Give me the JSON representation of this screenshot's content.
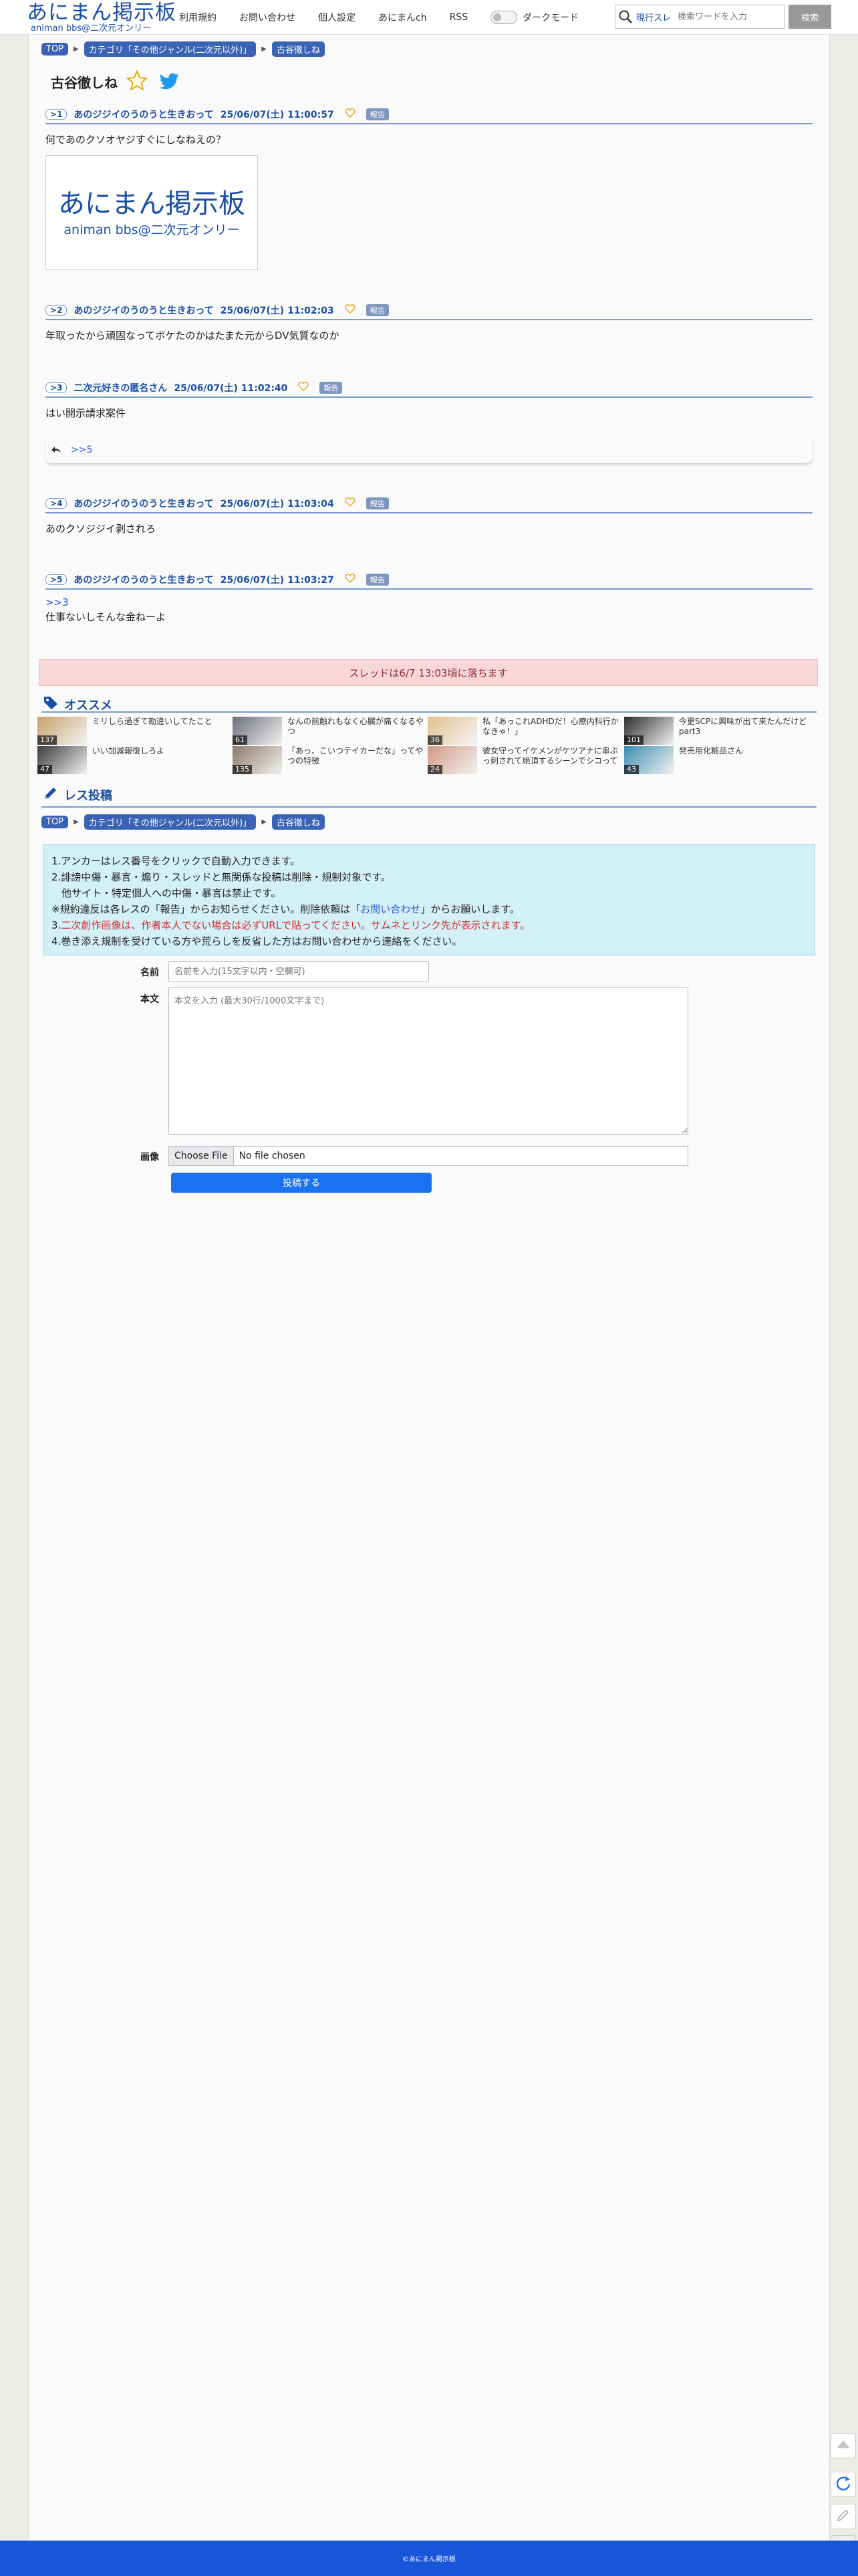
{
  "header": {
    "logo_main": "あにまん掲示板",
    "logo_sub": "animan bbs@二次元オンリー",
    "nav": [
      "利用規約",
      "お問い合わせ",
      "個人設定",
      "あにまんch",
      "RSS"
    ],
    "dark_mode_label": "ダークモード",
    "search_scope": "現行スレ",
    "search_placeholder": "検索ワードを入力",
    "search_button": "検索"
  },
  "breadcrumb": [
    "TOP",
    "カテゴリ「その他ジャンル(二次元以外)」",
    "古谷徹しね"
  ],
  "thread": {
    "title": "古谷徹しね"
  },
  "report_label": "報告",
  "posts": [
    {
      "num": "1",
      "name": "あのジジイのうのうと生きおって",
      "date": "25/06/07(土) 11:00:57",
      "body": "何であのクソオヤジすぐにしなねえの？"
    },
    {
      "num": "2",
      "name": "あのジジイのうのうと生きおって",
      "date": "25/06/07(土) 11:02:03",
      "body": "年取ったから頑固なってボケたのかはたまた元からDV気質なのか"
    },
    {
      "num": "3",
      "name": "二次元好きの匿名さん",
      "date": "25/06/07(土) 11:02:40",
      "body": "はい開示請求案件"
    },
    {
      "num": "4",
      "name": "あのジジイのうのうと生きおって",
      "date": "25/06/07(土) 11:03:04",
      "body": "あのクソジジイ剥されろ"
    },
    {
      "num": "5",
      "name": "あのジジイのうのうと生きおって",
      "date": "25/06/07(土) 11:03:27",
      "anchor": ">>3",
      "body": "仕事ないしそんな金ねーよ"
    }
  ],
  "post1_image": {
    "main": "あにまん掲示板",
    "sub": "animan bbs@二次元オンリー"
  },
  "reply_link": ">>5",
  "fall_notice": "スレッドは6/7 13:03頃に落ちます",
  "recommend": {
    "title": "オススメ",
    "items": [
      {
        "title": "ミリしら過ぎて勘違いしてたこと",
        "count": "137",
        "color": "#c8a26a"
      },
      {
        "title": "なんの前触れもなく心臓が痛くなるやつ",
        "count": "61",
        "color": "#6c6f78"
      },
      {
        "title": "私「あっこれADHDだ！心療内科行かなきゃ！」",
        "count": "36",
        "color": "#e3c08f"
      },
      {
        "title": "今更SCPに興味が出て来たんだけどpart3",
        "count": "101",
        "color": "#2d2d2d"
      },
      {
        "title": "いい加減報復しろよ",
        "count": "47",
        "color": "#3a3a3a"
      },
      {
        "title": "「あっ、こいつテイカーだな」ってやつの特徴",
        "count": "135",
        "color": "#8c7b6a"
      },
      {
        "title": "彼女守ってイケメンがケツアナに串ぶっ刺されて絶頂するシーンでシコってる",
        "count": "24",
        "color": "#d29a84"
      },
      {
        "title": "発売用化粧品さん",
        "count": "43",
        "color": "#3c8bb0"
      }
    ]
  },
  "post_form": {
    "title": "レス投稿",
    "rules": [
      "1.アンカーはレス番号をクリックで自動入力できます。",
      "2.誹謗中傷・暴言・煽り・スレッドと無関係な投稿は削除・規制対象です。",
      "　他サイト・特定個人への中傷・暴言は禁止です。",
      "※規約違反は各レスの「報告」からお知らせください。削除依頼は「",
      "お問い合わせ",
      "」からお願いします。",
      "3.",
      "二次創作画像は、作者本人でない場合は必ずURLで貼ってください。サムネとリンク先が表示されます。",
      "4.巻き添え規制を受けている方や荒らしを反省した方はお問い合わせから連絡をください。"
    ],
    "name_label": "名前",
    "name_placeholder": "名前を入力(15文字以内・空欄可)",
    "body_label": "本文",
    "body_placeholder": "本文を入力 (最大30行/1000文字まで)",
    "image_label": "画像",
    "file_button": "Choose File",
    "file_status": "No file chosen",
    "submit_label": "投稿する"
  },
  "footer": "©あにまん掲示板"
}
